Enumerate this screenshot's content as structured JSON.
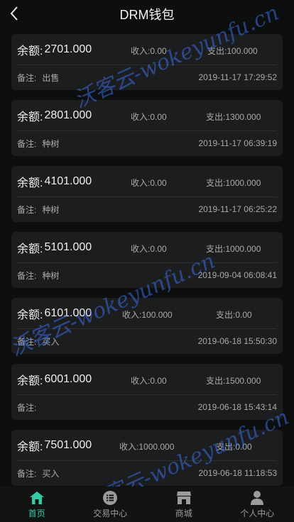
{
  "header": {
    "title": "DRM钱包"
  },
  "labels": {
    "balance": "余额:",
    "income": "收入:",
    "expense": "支出:",
    "note": "备注:"
  },
  "records": [
    {
      "balance": "2701.000",
      "income": "0.00",
      "expense": "100.000",
      "note": "出售",
      "time": "2019-11-17 17:29:52"
    },
    {
      "balance": "2801.000",
      "income": "0.00",
      "expense": "1300.000",
      "note": "种树",
      "time": "2019-11-17 06:39:19"
    },
    {
      "balance": "4101.000",
      "income": "0.00",
      "expense": "1000.000",
      "note": "种树",
      "time": "2019-11-17 06:25:22"
    },
    {
      "balance": "5101.000",
      "income": "0.00",
      "expense": "1000.000",
      "note": "种树",
      "time": "2019-09-04 06:08:41"
    },
    {
      "balance": "6101.000",
      "income": "100.000",
      "expense": "0.00",
      "note": "买入",
      "time": "2019-06-18 15:50:30"
    },
    {
      "balance": "6001.000",
      "income": "0.00",
      "expense": "1500.000",
      "note": "",
      "time": "2019-06-18 15:43:14"
    },
    {
      "balance": "7501.000",
      "income": "1000.000",
      "expense": "0.00",
      "note": "买入",
      "time": "2019-06-18 11:18:53"
    }
  ],
  "tabbar": [
    {
      "label": "首页",
      "icon": "home-icon",
      "active": true
    },
    {
      "label": "交易中心",
      "icon": "list-icon",
      "active": false
    },
    {
      "label": "商城",
      "icon": "store-icon",
      "active": false
    },
    {
      "label": "个人中心",
      "icon": "user-icon",
      "active": false
    }
  ],
  "watermark": {
    "text": "沃客云-wokeyunfu.cn"
  },
  "colors": {
    "accent": "#35c9a4",
    "background": "#0d0f0f",
    "card": "#1b1d1e"
  }
}
